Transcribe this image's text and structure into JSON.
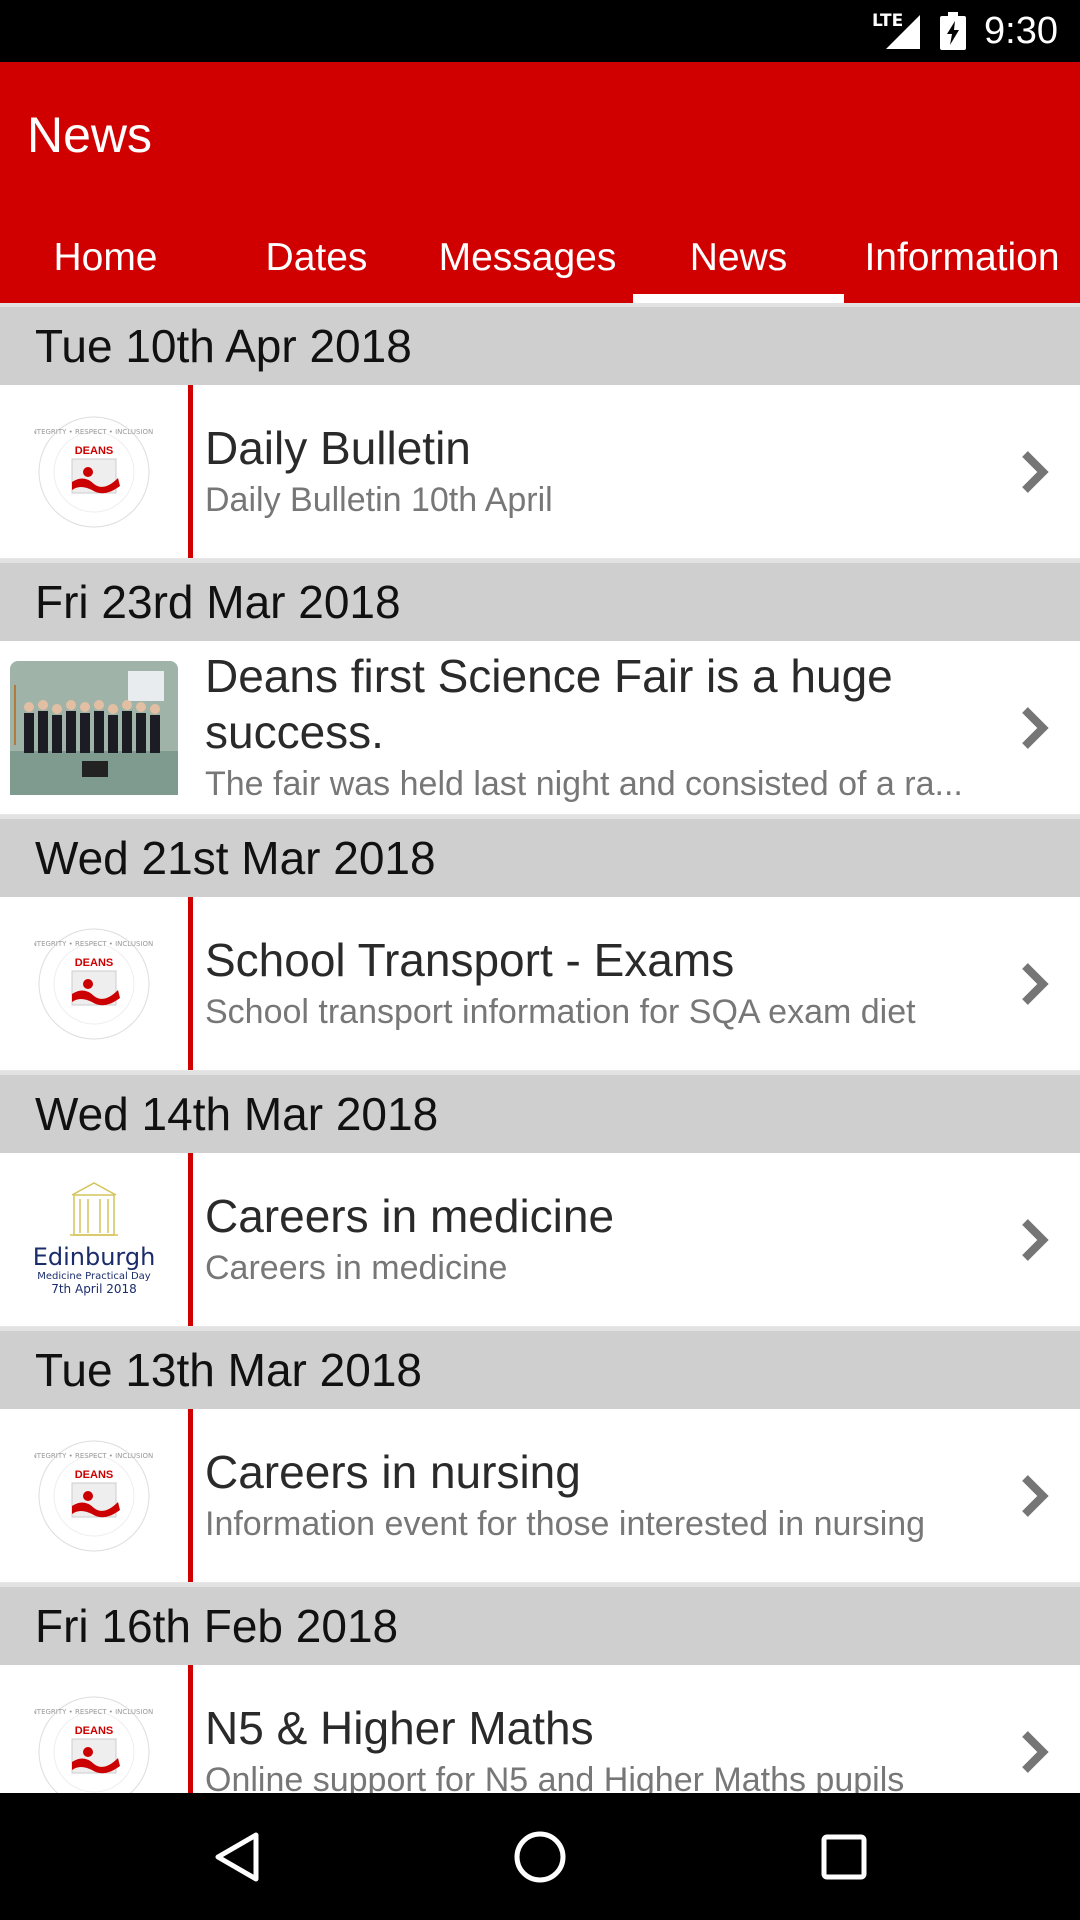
{
  "status": {
    "network": "LTE",
    "time": "9:30"
  },
  "app": {
    "title": "News"
  },
  "tabs": [
    {
      "label": "Home",
      "active": false
    },
    {
      "label": "Dates",
      "active": false
    },
    {
      "label": "Messages",
      "active": false
    },
    {
      "label": "News",
      "active": true
    },
    {
      "label": "Information",
      "active": false
    }
  ],
  "sections": [
    {
      "date": "Tue 10th Apr 2018",
      "item": {
        "title": "Daily Bulletin",
        "subtitle": "Daily Bulletin 10th April",
        "thumb": "deans-logo"
      }
    },
    {
      "date": "Fri 23rd Mar 2018",
      "item": {
        "title": "Deans first Science Fair is a huge success.",
        "subtitle": "The fair was held last night and consisted of a ra...",
        "thumb": "group-photo"
      }
    },
    {
      "date": "Wed 21st Mar 2018",
      "item": {
        "title": "School Transport - Exams",
        "subtitle": "School transport information for SQA exam diet",
        "thumb": "deans-logo"
      }
    },
    {
      "date": "Wed 14th Mar 2018",
      "item": {
        "title": "Careers in medicine",
        "subtitle": "Careers in medicine",
        "thumb": "edinburgh-logo"
      }
    },
    {
      "date": "Tue 13th Mar 2018",
      "item": {
        "title": "Careers in nursing",
        "subtitle": "Information event for those interested in nursing",
        "thumb": "deans-logo"
      }
    },
    {
      "date": "Fri 16th Feb 2018",
      "item": {
        "title": "N5 & Higher Maths",
        "subtitle": "Online support for N5 and Higher Maths pupils",
        "thumb": "deans-logo"
      }
    }
  ],
  "logos": {
    "deans": {
      "name": "DEANS",
      "ring": "ASPIRATION • INTEGRITY • RESPECT • INCLUSION • COMPASSION"
    },
    "edinburgh": {
      "name": "Edinburgh",
      "line1": "Medicine Practical Day",
      "line2": "7th April 2018"
    }
  },
  "colors": {
    "brand_red": "#d10000",
    "header_grey": "#cfcfcf",
    "status_black": "#000000"
  },
  "icons": {
    "chevron": "chevron-right-icon",
    "back": "back-triangle-icon",
    "home": "home-circle-icon",
    "recents": "recents-square-icon"
  }
}
